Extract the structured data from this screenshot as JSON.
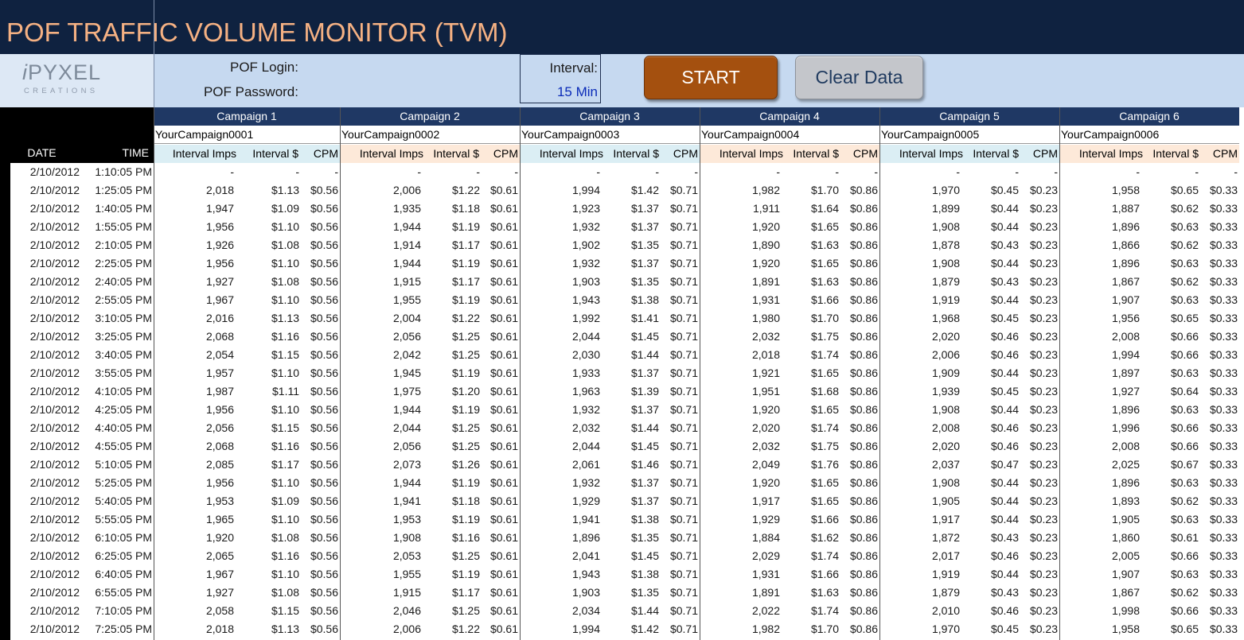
{
  "title": "POF TRAFFIC VOLUME MONITOR (TVM)",
  "logo": {
    "main_i": "i",
    "main_rest": "PYXEL",
    "sub": "CREATIONS"
  },
  "controls": {
    "login_label": "POF Login:",
    "password_label": "POF Password:",
    "interval_label": "Interval:",
    "interval_value": "15 Min",
    "start_label": "START",
    "clear_label": "Clear Data"
  },
  "colors": {
    "title_bg": "#0f2240",
    "title_text": "#f5b183",
    "control_bg": "#c6d9f0",
    "campaign_header_bg": "#1f3864",
    "col_header_blue": "#dbeef4",
    "col_header_peach": "#fde9d9",
    "start_btn": "#a4500f",
    "clear_btn": "#c4c6cb"
  },
  "table": {
    "date_header": "DATE",
    "time_header": "TIME",
    "column_labels": [
      "Interval Imps",
      "Interval $",
      "CPM"
    ],
    "campaigns": [
      {
        "header": "Campaign 1",
        "name": "YourCampaign0001"
      },
      {
        "header": "Campaign 2",
        "name": "YourCampaign0002"
      },
      {
        "header": "Campaign 3",
        "name": "YourCampaign0003"
      },
      {
        "header": "Campaign 4",
        "name": "YourCampaign0004"
      },
      {
        "header": "Campaign 5",
        "name": "YourCampaign0005"
      },
      {
        "header": "Campaign 6",
        "name": "YourCampaign0006"
      }
    ],
    "rows": [
      {
        "date": "2/10/2012",
        "time": "1:10:05 PM",
        "c": [
          [
            "-",
            "-",
            "-"
          ],
          [
            "-",
            "-",
            "-"
          ],
          [
            "-",
            "-",
            "-"
          ],
          [
            "-",
            "-",
            "-"
          ],
          [
            "-",
            "-",
            "-"
          ],
          [
            "-",
            "-",
            "-"
          ]
        ]
      },
      {
        "date": "2/10/2012",
        "time": "1:25:05 PM",
        "c": [
          [
            "2,018",
            "$1.13",
            "$0.56"
          ],
          [
            "2,006",
            "$1.22",
            "$0.61"
          ],
          [
            "1,994",
            "$1.42",
            "$0.71"
          ],
          [
            "1,982",
            "$1.70",
            "$0.86"
          ],
          [
            "1,970",
            "$0.45",
            "$0.23"
          ],
          [
            "1,958",
            "$0.65",
            "$0.33"
          ]
        ]
      },
      {
        "date": "2/10/2012",
        "time": "1:40:05 PM",
        "c": [
          [
            "1,947",
            "$1.09",
            "$0.56"
          ],
          [
            "1,935",
            "$1.18",
            "$0.61"
          ],
          [
            "1,923",
            "$1.37",
            "$0.71"
          ],
          [
            "1,911",
            "$1.64",
            "$0.86"
          ],
          [
            "1,899",
            "$0.44",
            "$0.23"
          ],
          [
            "1,887",
            "$0.62",
            "$0.33"
          ]
        ]
      },
      {
        "date": "2/10/2012",
        "time": "1:55:05 PM",
        "c": [
          [
            "1,956",
            "$1.10",
            "$0.56"
          ],
          [
            "1,944",
            "$1.19",
            "$0.61"
          ],
          [
            "1,932",
            "$1.37",
            "$0.71"
          ],
          [
            "1,920",
            "$1.65",
            "$0.86"
          ],
          [
            "1,908",
            "$0.44",
            "$0.23"
          ],
          [
            "1,896",
            "$0.63",
            "$0.33"
          ]
        ]
      },
      {
        "date": "2/10/2012",
        "time": "2:10:05 PM",
        "c": [
          [
            "1,926",
            "$1.08",
            "$0.56"
          ],
          [
            "1,914",
            "$1.17",
            "$0.61"
          ],
          [
            "1,902",
            "$1.35",
            "$0.71"
          ],
          [
            "1,890",
            "$1.63",
            "$0.86"
          ],
          [
            "1,878",
            "$0.43",
            "$0.23"
          ],
          [
            "1,866",
            "$0.62",
            "$0.33"
          ]
        ]
      },
      {
        "date": "2/10/2012",
        "time": "2:25:05 PM",
        "c": [
          [
            "1,956",
            "$1.10",
            "$0.56"
          ],
          [
            "1,944",
            "$1.19",
            "$0.61"
          ],
          [
            "1,932",
            "$1.37",
            "$0.71"
          ],
          [
            "1,920",
            "$1.65",
            "$0.86"
          ],
          [
            "1,908",
            "$0.44",
            "$0.23"
          ],
          [
            "1,896",
            "$0.63",
            "$0.33"
          ]
        ]
      },
      {
        "date": "2/10/2012",
        "time": "2:40:05 PM",
        "c": [
          [
            "1,927",
            "$1.08",
            "$0.56"
          ],
          [
            "1,915",
            "$1.17",
            "$0.61"
          ],
          [
            "1,903",
            "$1.35",
            "$0.71"
          ],
          [
            "1,891",
            "$1.63",
            "$0.86"
          ],
          [
            "1,879",
            "$0.43",
            "$0.23"
          ],
          [
            "1,867",
            "$0.62",
            "$0.33"
          ]
        ]
      },
      {
        "date": "2/10/2012",
        "time": "2:55:05 PM",
        "c": [
          [
            "1,967",
            "$1.10",
            "$0.56"
          ],
          [
            "1,955",
            "$1.19",
            "$0.61"
          ],
          [
            "1,943",
            "$1.38",
            "$0.71"
          ],
          [
            "1,931",
            "$1.66",
            "$0.86"
          ],
          [
            "1,919",
            "$0.44",
            "$0.23"
          ],
          [
            "1,907",
            "$0.63",
            "$0.33"
          ]
        ]
      },
      {
        "date": "2/10/2012",
        "time": "3:10:05 PM",
        "c": [
          [
            "2,016",
            "$1.13",
            "$0.56"
          ],
          [
            "2,004",
            "$1.22",
            "$0.61"
          ],
          [
            "1,992",
            "$1.41",
            "$0.71"
          ],
          [
            "1,980",
            "$1.70",
            "$0.86"
          ],
          [
            "1,968",
            "$0.45",
            "$0.23"
          ],
          [
            "1,956",
            "$0.65",
            "$0.33"
          ]
        ]
      },
      {
        "date": "2/10/2012",
        "time": "3:25:05 PM",
        "c": [
          [
            "2,068",
            "$1.16",
            "$0.56"
          ],
          [
            "2,056",
            "$1.25",
            "$0.61"
          ],
          [
            "2,044",
            "$1.45",
            "$0.71"
          ],
          [
            "2,032",
            "$1.75",
            "$0.86"
          ],
          [
            "2,020",
            "$0.46",
            "$0.23"
          ],
          [
            "2,008",
            "$0.66",
            "$0.33"
          ]
        ]
      },
      {
        "date": "2/10/2012",
        "time": "3:40:05 PM",
        "c": [
          [
            "2,054",
            "$1.15",
            "$0.56"
          ],
          [
            "2,042",
            "$1.25",
            "$0.61"
          ],
          [
            "2,030",
            "$1.44",
            "$0.71"
          ],
          [
            "2,018",
            "$1.74",
            "$0.86"
          ],
          [
            "2,006",
            "$0.46",
            "$0.23"
          ],
          [
            "1,994",
            "$0.66",
            "$0.33"
          ]
        ]
      },
      {
        "date": "2/10/2012",
        "time": "3:55:05 PM",
        "c": [
          [
            "1,957",
            "$1.10",
            "$0.56"
          ],
          [
            "1,945",
            "$1.19",
            "$0.61"
          ],
          [
            "1,933",
            "$1.37",
            "$0.71"
          ],
          [
            "1,921",
            "$1.65",
            "$0.86"
          ],
          [
            "1,909",
            "$0.44",
            "$0.23"
          ],
          [
            "1,897",
            "$0.63",
            "$0.33"
          ]
        ]
      },
      {
        "date": "2/10/2012",
        "time": "4:10:05 PM",
        "c": [
          [
            "1,987",
            "$1.11",
            "$0.56"
          ],
          [
            "1,975",
            "$1.20",
            "$0.61"
          ],
          [
            "1,963",
            "$1.39",
            "$0.71"
          ],
          [
            "1,951",
            "$1.68",
            "$0.86"
          ],
          [
            "1,939",
            "$0.45",
            "$0.23"
          ],
          [
            "1,927",
            "$0.64",
            "$0.33"
          ]
        ]
      },
      {
        "date": "2/10/2012",
        "time": "4:25:05 PM",
        "c": [
          [
            "1,956",
            "$1.10",
            "$0.56"
          ],
          [
            "1,944",
            "$1.19",
            "$0.61"
          ],
          [
            "1,932",
            "$1.37",
            "$0.71"
          ],
          [
            "1,920",
            "$1.65",
            "$0.86"
          ],
          [
            "1,908",
            "$0.44",
            "$0.23"
          ],
          [
            "1,896",
            "$0.63",
            "$0.33"
          ]
        ]
      },
      {
        "date": "2/10/2012",
        "time": "4:40:05 PM",
        "c": [
          [
            "2,056",
            "$1.15",
            "$0.56"
          ],
          [
            "2,044",
            "$1.25",
            "$0.61"
          ],
          [
            "2,032",
            "$1.44",
            "$0.71"
          ],
          [
            "2,020",
            "$1.74",
            "$0.86"
          ],
          [
            "2,008",
            "$0.46",
            "$0.23"
          ],
          [
            "1,996",
            "$0.66",
            "$0.33"
          ]
        ]
      },
      {
        "date": "2/10/2012",
        "time": "4:55:05 PM",
        "c": [
          [
            "2,068",
            "$1.16",
            "$0.56"
          ],
          [
            "2,056",
            "$1.25",
            "$0.61"
          ],
          [
            "2,044",
            "$1.45",
            "$0.71"
          ],
          [
            "2,032",
            "$1.75",
            "$0.86"
          ],
          [
            "2,020",
            "$0.46",
            "$0.23"
          ],
          [
            "2,008",
            "$0.66",
            "$0.33"
          ]
        ]
      },
      {
        "date": "2/10/2012",
        "time": "5:10:05 PM",
        "c": [
          [
            "2,085",
            "$1.17",
            "$0.56"
          ],
          [
            "2,073",
            "$1.26",
            "$0.61"
          ],
          [
            "2,061",
            "$1.46",
            "$0.71"
          ],
          [
            "2,049",
            "$1.76",
            "$0.86"
          ],
          [
            "2,037",
            "$0.47",
            "$0.23"
          ],
          [
            "2,025",
            "$0.67",
            "$0.33"
          ]
        ]
      },
      {
        "date": "2/10/2012",
        "time": "5:25:05 PM",
        "c": [
          [
            "1,956",
            "$1.10",
            "$0.56"
          ],
          [
            "1,944",
            "$1.19",
            "$0.61"
          ],
          [
            "1,932",
            "$1.37",
            "$0.71"
          ],
          [
            "1,920",
            "$1.65",
            "$0.86"
          ],
          [
            "1,908",
            "$0.44",
            "$0.23"
          ],
          [
            "1,896",
            "$0.63",
            "$0.33"
          ]
        ]
      },
      {
        "date": "2/10/2012",
        "time": "5:40:05 PM",
        "c": [
          [
            "1,953",
            "$1.09",
            "$0.56"
          ],
          [
            "1,941",
            "$1.18",
            "$0.61"
          ],
          [
            "1,929",
            "$1.37",
            "$0.71"
          ],
          [
            "1,917",
            "$1.65",
            "$0.86"
          ],
          [
            "1,905",
            "$0.44",
            "$0.23"
          ],
          [
            "1,893",
            "$0.62",
            "$0.33"
          ]
        ]
      },
      {
        "date": "2/10/2012",
        "time": "5:55:05 PM",
        "c": [
          [
            "1,965",
            "$1.10",
            "$0.56"
          ],
          [
            "1,953",
            "$1.19",
            "$0.61"
          ],
          [
            "1,941",
            "$1.38",
            "$0.71"
          ],
          [
            "1,929",
            "$1.66",
            "$0.86"
          ],
          [
            "1,917",
            "$0.44",
            "$0.23"
          ],
          [
            "1,905",
            "$0.63",
            "$0.33"
          ]
        ]
      },
      {
        "date": "2/10/2012",
        "time": "6:10:05 PM",
        "c": [
          [
            "1,920",
            "$1.08",
            "$0.56"
          ],
          [
            "1,908",
            "$1.16",
            "$0.61"
          ],
          [
            "1,896",
            "$1.35",
            "$0.71"
          ],
          [
            "1,884",
            "$1.62",
            "$0.86"
          ],
          [
            "1,872",
            "$0.43",
            "$0.23"
          ],
          [
            "1,860",
            "$0.61",
            "$0.33"
          ]
        ]
      },
      {
        "date": "2/10/2012",
        "time": "6:25:05 PM",
        "c": [
          [
            "2,065",
            "$1.16",
            "$0.56"
          ],
          [
            "2,053",
            "$1.25",
            "$0.61"
          ],
          [
            "2,041",
            "$1.45",
            "$0.71"
          ],
          [
            "2,029",
            "$1.74",
            "$0.86"
          ],
          [
            "2,017",
            "$0.46",
            "$0.23"
          ],
          [
            "2,005",
            "$0.66",
            "$0.33"
          ]
        ]
      },
      {
        "date": "2/10/2012",
        "time": "6:40:05 PM",
        "c": [
          [
            "1,967",
            "$1.10",
            "$0.56"
          ],
          [
            "1,955",
            "$1.19",
            "$0.61"
          ],
          [
            "1,943",
            "$1.38",
            "$0.71"
          ],
          [
            "1,931",
            "$1.66",
            "$0.86"
          ],
          [
            "1,919",
            "$0.44",
            "$0.23"
          ],
          [
            "1,907",
            "$0.63",
            "$0.33"
          ]
        ]
      },
      {
        "date": "2/10/2012",
        "time": "6:55:05 PM",
        "c": [
          [
            "1,927",
            "$1.08",
            "$0.56"
          ],
          [
            "1,915",
            "$1.17",
            "$0.61"
          ],
          [
            "1,903",
            "$1.35",
            "$0.71"
          ],
          [
            "1,891",
            "$1.63",
            "$0.86"
          ],
          [
            "1,879",
            "$0.43",
            "$0.23"
          ],
          [
            "1,867",
            "$0.62",
            "$0.33"
          ]
        ]
      },
      {
        "date": "2/10/2012",
        "time": "7:10:05 PM",
        "c": [
          [
            "2,058",
            "$1.15",
            "$0.56"
          ],
          [
            "2,046",
            "$1.25",
            "$0.61"
          ],
          [
            "2,034",
            "$1.44",
            "$0.71"
          ],
          [
            "2,022",
            "$1.74",
            "$0.86"
          ],
          [
            "2,010",
            "$0.46",
            "$0.23"
          ],
          [
            "1,998",
            "$0.66",
            "$0.33"
          ]
        ]
      },
      {
        "date": "2/10/2012",
        "time": "7:25:05 PM",
        "c": [
          [
            "2,018",
            "$1.13",
            "$0.56"
          ],
          [
            "2,006",
            "$1.22",
            "$0.61"
          ],
          [
            "1,994",
            "$1.42",
            "$0.71"
          ],
          [
            "1,982",
            "$1.70",
            "$0.86"
          ],
          [
            "1,970",
            "$0.45",
            "$0.23"
          ],
          [
            "1,958",
            "$0.65",
            "$0.33"
          ]
        ]
      }
    ]
  }
}
